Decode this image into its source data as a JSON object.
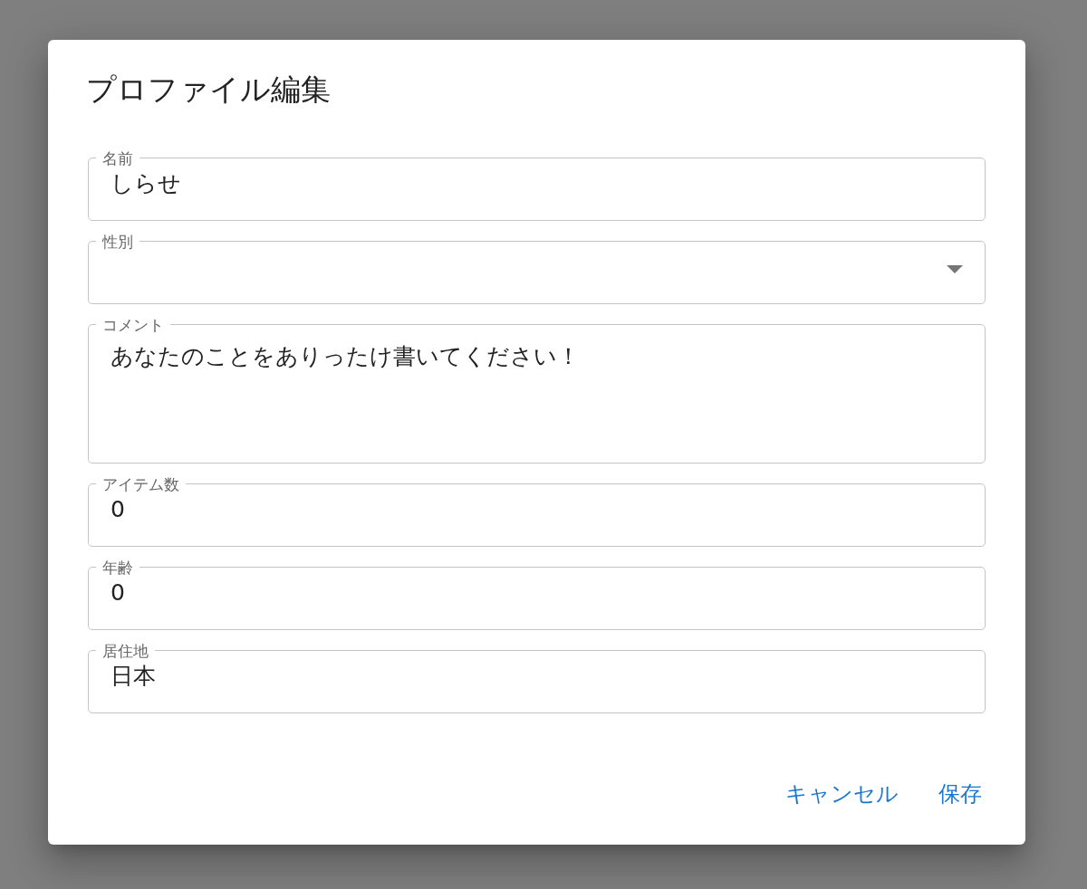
{
  "dialog": {
    "title": "プロファイル編集",
    "fields": [
      {
        "kind": "text",
        "label": "名前",
        "value": "しらせ"
      },
      {
        "kind": "select",
        "label": "性別"
      },
      {
        "kind": "multiline",
        "label": "コメント",
        "value": "あなたのことをありったけ書いてください！"
      },
      {
        "kind": "text",
        "label": "アイテム数",
        "value": "0"
      },
      {
        "kind": "text",
        "label": "年齢",
        "value": "0"
      },
      {
        "kind": "text",
        "label": "居住地",
        "value": "日本"
      }
    ],
    "buttons": [
      "キャンセル",
      "保存"
    ]
  }
}
